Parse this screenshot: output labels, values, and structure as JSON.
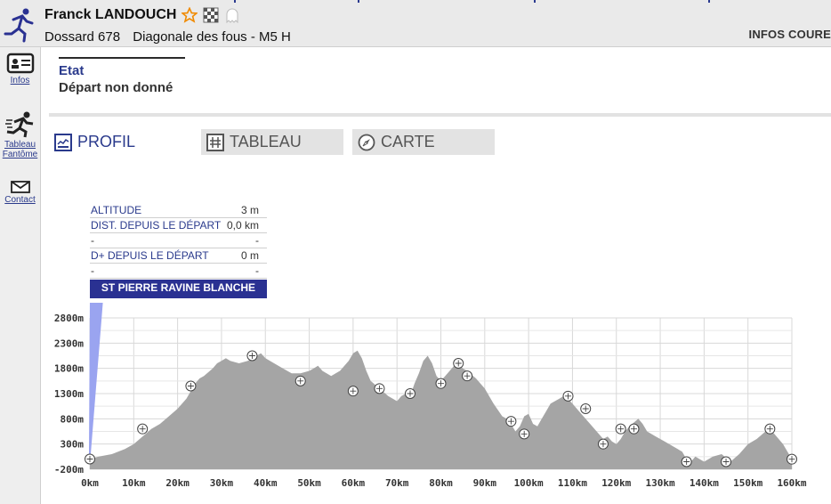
{
  "header": {
    "runner_name": "Franck LANDOUCH",
    "bib": "Dossard 678",
    "race": "Diagonale des fous - M5 H",
    "infos_course": "INFOS COURE",
    "icons": [
      "runner-logo-icon",
      "star-icon",
      "checkered-flag-icon",
      "ghost-icon"
    ]
  },
  "sidebar": {
    "items": [
      {
        "label": "Infos",
        "icon": "id-card-icon"
      },
      {
        "label": "Tableau Fantôme",
        "icon": "running-man-icon"
      },
      {
        "label": "Contact",
        "icon": "envelope-icon"
      }
    ]
  },
  "status": {
    "label": "Etat",
    "value": "Départ non donné"
  },
  "tabs": [
    {
      "label": "PROFIL",
      "icon": "profile-chart-icon",
      "active": true
    },
    {
      "label": "TABLEAU",
      "icon": "grid-icon",
      "active": false
    },
    {
      "label": "CARTE",
      "icon": "compass-icon",
      "active": false
    }
  ],
  "info_panel": {
    "rows": [
      {
        "label": "ALTITUDE",
        "value": "3 m"
      },
      {
        "label": "DIST. DEPUIS LE DÉPART",
        "value": "0,0 km"
      },
      {
        "label": "-",
        "value": "-"
      },
      {
        "label": "D+ DEPUIS LE DÉPART",
        "value": "0 m"
      },
      {
        "label": "-",
        "value": "-"
      }
    ],
    "station": "ST PIERRE RAVINE BLANCHE"
  },
  "chart_data": {
    "type": "area",
    "fill_color": "#a5a5a5",
    "grid": true,
    "x_ticks": [
      "0km",
      "10km",
      "20km",
      "30km",
      "40km",
      "50km",
      "60km",
      "70km",
      "80km",
      "90km",
      "100km",
      "110km",
      "120km",
      "130km",
      "140km",
      "150km",
      "160km"
    ],
    "y_ticks": [
      "-200m",
      "300m",
      "800m",
      "1300m",
      "1800m",
      "2300m",
      "2800m"
    ],
    "xlim": [
      0,
      160
    ],
    "ylim": [
      -200,
      2800
    ],
    "profile": [
      [
        0,
        3
      ],
      [
        2,
        50
      ],
      [
        5,
        100
      ],
      [
        8,
        200
      ],
      [
        10,
        300
      ],
      [
        12,
        450
      ],
      [
        14,
        600
      ],
      [
        16,
        700
      ],
      [
        18,
        850
      ],
      [
        20,
        1000
      ],
      [
        22,
        1200
      ],
      [
        23,
        1350
      ],
      [
        24,
        1500
      ],
      [
        25,
        1600
      ],
      [
        26,
        1650
      ],
      [
        28,
        1800
      ],
      [
        29,
        1900
      ],
      [
        30,
        1950
      ],
      [
        31,
        2000
      ],
      [
        32,
        1950
      ],
      [
        34,
        1900
      ],
      [
        36,
        1950
      ],
      [
        37,
        2000
      ],
      [
        38,
        2050
      ],
      [
        39,
        2100
      ],
      [
        40,
        2000
      ],
      [
        42,
        1900
      ],
      [
        44,
        1800
      ],
      [
        46,
        1700
      ],
      [
        48,
        1700
      ],
      [
        50,
        1750
      ],
      [
        51,
        1800
      ],
      [
        52,
        1850
      ],
      [
        53,
        1750
      ],
      [
        55,
        1650
      ],
      [
        57,
        1750
      ],
      [
        59,
        1950
      ],
      [
        60,
        2100
      ],
      [
        61,
        2150
      ],
      [
        62,
        2000
      ],
      [
        63,
        1750
      ],
      [
        64,
        1550
      ],
      [
        66,
        1400
      ],
      [
        68,
        1250
      ],
      [
        70,
        1150
      ],
      [
        71,
        1250
      ],
      [
        72,
        1300
      ],
      [
        73,
        1250
      ],
      [
        74,
        1500
      ],
      [
        75,
        1700
      ],
      [
        76,
        1950
      ],
      [
        77,
        2050
      ],
      [
        78,
        1900
      ],
      [
        79,
        1650
      ],
      [
        80,
        1550
      ],
      [
        81,
        1650
      ],
      [
        82,
        1750
      ],
      [
        83,
        1850
      ],
      [
        84,
        1900
      ],
      [
        85,
        1800
      ],
      [
        86,
        1750
      ],
      [
        88,
        1600
      ],
      [
        90,
        1400
      ],
      [
        92,
        1100
      ],
      [
        94,
        850
      ],
      [
        95,
        800
      ],
      [
        96,
        700
      ],
      [
        97,
        550
      ],
      [
        98,
        650
      ],
      [
        99,
        850
      ],
      [
        100,
        900
      ],
      [
        101,
        700
      ],
      [
        102,
        650
      ],
      [
        103,
        800
      ],
      [
        104,
        950
      ],
      [
        105,
        1100
      ],
      [
        107,
        1200
      ],
      [
        108,
        1250
      ],
      [
        109,
        1200
      ],
      [
        110,
        1100
      ],
      [
        112,
        900
      ],
      [
        114,
        700
      ],
      [
        116,
        500
      ],
      [
        117,
        400
      ],
      [
        118,
        450
      ],
      [
        119,
        350
      ],
      [
        120,
        300
      ],
      [
        121,
        400
      ],
      [
        122,
        550
      ],
      [
        123,
        650
      ],
      [
        125,
        800
      ],
      [
        126,
        700
      ],
      [
        127,
        550
      ],
      [
        129,
        450
      ],
      [
        131,
        350
      ],
      [
        133,
        250
      ],
      [
        135,
        150
      ],
      [
        136,
        0
      ],
      [
        137,
        -50
      ],
      [
        138,
        50
      ],
      [
        140,
        -50
      ],
      [
        142,
        50
      ],
      [
        144,
        100
      ],
      [
        146,
        -50
      ],
      [
        148,
        100
      ],
      [
        150,
        300
      ],
      [
        152,
        400
      ],
      [
        154,
        550
      ],
      [
        155,
        600
      ],
      [
        156,
        500
      ],
      [
        158,
        300
      ],
      [
        160,
        0
      ]
    ],
    "markers": [
      [
        0,
        3
      ],
      [
        12,
        600
      ],
      [
        23,
        1450
      ],
      [
        37,
        2050
      ],
      [
        48,
        1550
      ],
      [
        60,
        1350
      ],
      [
        66,
        1400
      ],
      [
        73,
        1300
      ],
      [
        80,
        1500
      ],
      [
        84,
        1900
      ],
      [
        86,
        1650
      ],
      [
        96,
        750
      ],
      [
        99,
        500
      ],
      [
        109,
        1250
      ],
      [
        113,
        1000
      ],
      [
        117,
        300
      ],
      [
        121,
        600
      ],
      [
        124,
        600
      ],
      [
        136,
        -50
      ],
      [
        145,
        -50
      ],
      [
        155,
        600
      ],
      [
        160,
        0
      ]
    ]
  }
}
